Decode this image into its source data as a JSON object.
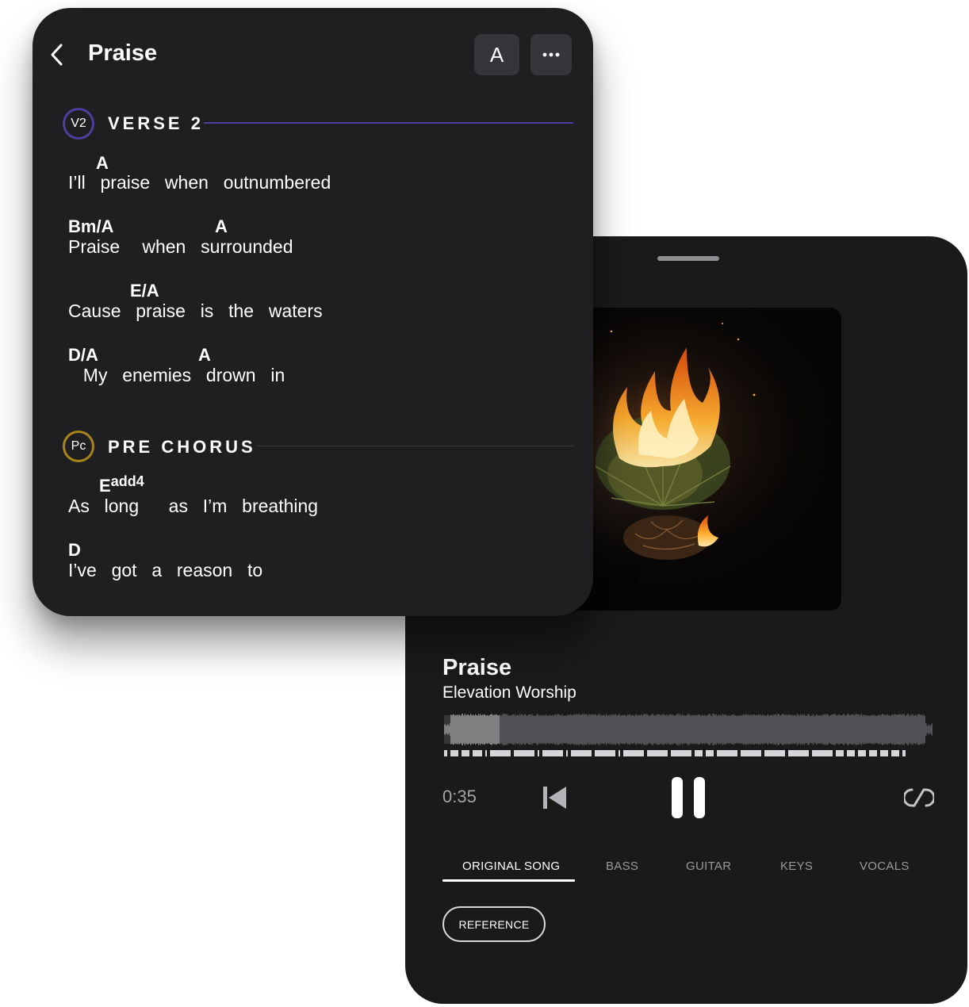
{
  "sheet": {
    "title": "Praise",
    "key_button": "A",
    "sections": [
      {
        "badge": "V2",
        "name": "VERSE 2",
        "accent": "#4e3f9e",
        "lines": [
          {
            "chords": [
              {
                "text": "A"
              }
            ],
            "lyric": "I’ll  praise  when  outnumbered"
          },
          {
            "chords": [
              {
                "text": "Bm/A"
              },
              {
                "text": "A"
              }
            ],
            "lyric": "Praise   when  surrounded"
          },
          {
            "chords": [
              {
                "text": "E/A"
              }
            ],
            "lyric": "Cause  praise  is  the  waters"
          },
          {
            "chords": [
              {
                "text": "D/A"
              },
              {
                "text": "A"
              }
            ],
            "lyric": "  My  enemies  drown  in"
          }
        ]
      },
      {
        "badge": "Pc",
        "name": "PRE CHORUS",
        "accent": "#a88419",
        "lines": [
          {
            "chords": [
              {
                "text": "E",
                "sup": "add4"
              }
            ],
            "lyric": "As  long    as  I’m  breathing"
          },
          {
            "chords": [
              {
                "text": "D"
              }
            ],
            "lyric": "I’ve  got  a  reason  to"
          }
        ]
      }
    ]
  },
  "player": {
    "title": "Praise",
    "artist": "Elevation Worship",
    "time": "0:35",
    "progress": 0.115,
    "accent": "#4e3f9e",
    "tabs": [
      {
        "label": "ORIGINAL SONG",
        "active": true
      },
      {
        "label": "BASS",
        "active": false
      },
      {
        "label": "GUITAR",
        "active": false
      },
      {
        "label": "KEYS",
        "active": false
      },
      {
        "label": "VOCALS",
        "active": false
      }
    ],
    "reference_button": "REFERENCE"
  }
}
